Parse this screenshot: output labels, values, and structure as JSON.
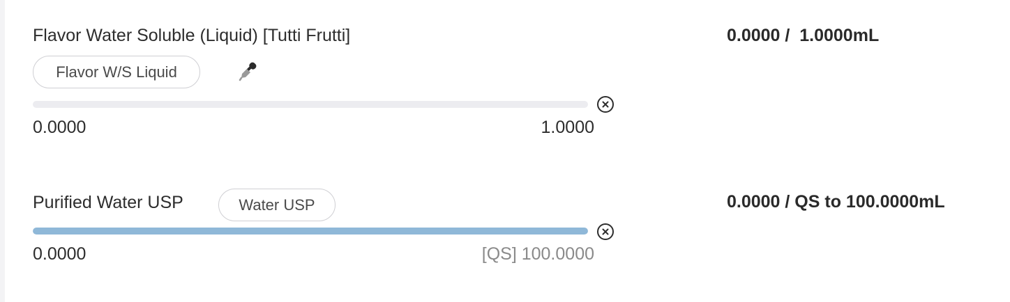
{
  "ingredients": [
    {
      "name": "Flavor Water Soluble (Liquid) [Tutti Frutti]",
      "tag": "Flavor W/S Liquid",
      "icon": "dropper-icon",
      "slider_fill": 0,
      "min_label": "0.0000",
      "max_label": "1.0000",
      "amount_text": "0.0000 /  1.0000mL"
    },
    {
      "name": "Purified Water USP",
      "tag": "Water USP",
      "slider_fill": 1,
      "min_label": "0.0000",
      "max_label": "[QS] 100.0000",
      "amount_text": "0.0000 / QS to 100.0000mL"
    }
  ],
  "colors": {
    "track": "#ececf0",
    "fill": "#8fb8d8",
    "qs_text": "#8a8a8a"
  }
}
